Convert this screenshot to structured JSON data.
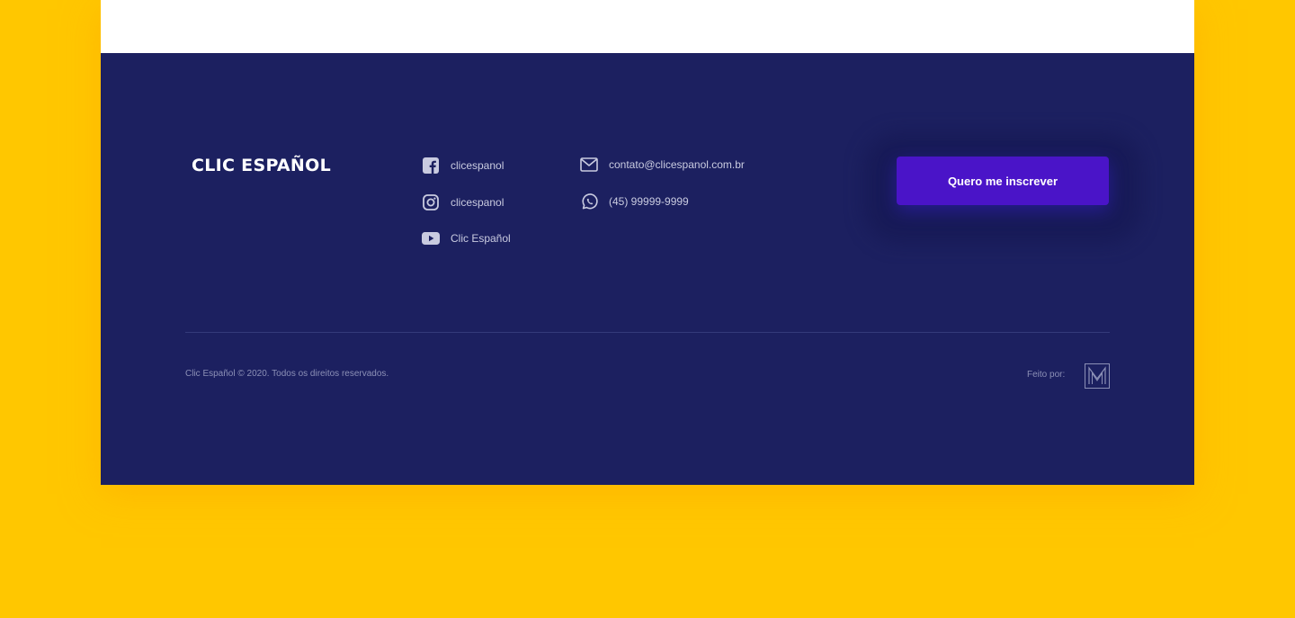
{
  "footer": {
    "brand": "CLIC ESPAÑOL",
    "social": {
      "facebook": "clicespanol",
      "instagram": "clicespanol",
      "youtube": "Clic Español"
    },
    "contact": {
      "email": "contato@clicespanol.com.br",
      "phone": "(45) 99999-9999"
    },
    "cta_label": "Quero me inscrever",
    "copyright": "Clic Español © 2020. Todos os direitos reservados.",
    "made_by_label": "Feito por:"
  },
  "colors": {
    "page_background": "#FFC700",
    "footer_background": "#1C2060",
    "cta_background": "#4A14C8"
  },
  "icons": [
    "facebook-icon",
    "instagram-icon",
    "youtube-icon",
    "mail-icon",
    "whatsapp-icon",
    "maker-logo-icon"
  ]
}
